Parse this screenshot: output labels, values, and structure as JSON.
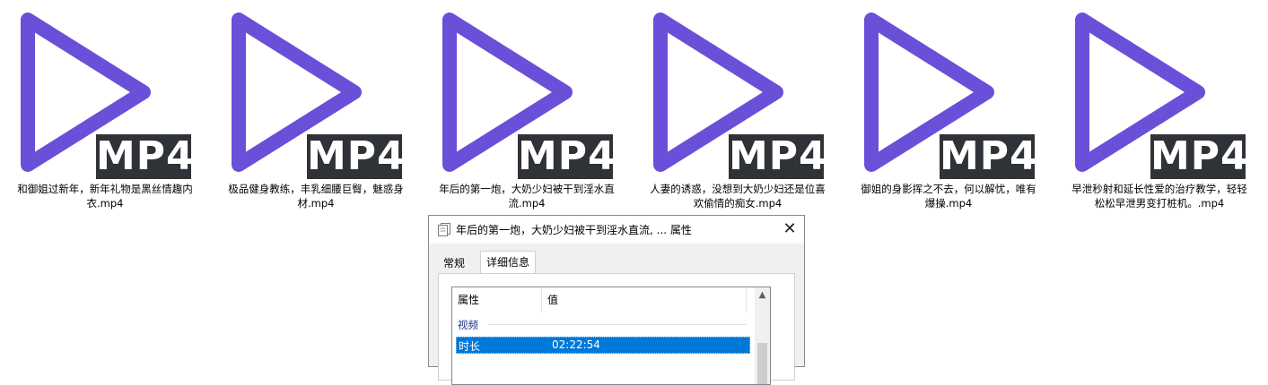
{
  "files": [
    {
      "name": "和御姐过新年，新年礼物是黑丝情趣内衣.mp4",
      "badge": "MP4",
      "icon": "play-icon"
    },
    {
      "name": "极品健身教练，丰乳细腰巨臀，魅惑身材.mp4",
      "badge": "MP4",
      "icon": "play-icon"
    },
    {
      "name": "年后的第一炮，大奶少妇被干到淫水直流.mp4",
      "badge": "MP4",
      "icon": "play-icon"
    },
    {
      "name": "人妻的诱惑，没想到大奶少妇还是位喜欢偷情的痴女.mp4",
      "badge": "MP4",
      "icon": "play-icon"
    },
    {
      "name": "御姐的身影挥之不去，何以解忧，唯有爆操.mp4",
      "badge": "MP4",
      "icon": "play-icon"
    },
    {
      "name": "早泄秒射和延长性爱的治疗教学，轻轻松松早泄男变打桩机。.mp4",
      "badge": "MP4",
      "icon": "play-icon"
    }
  ],
  "colors": {
    "play": "#6a4fd8",
    "badge_bg": "#2f3237",
    "selection": "#0078d7"
  },
  "dialog": {
    "title": "年后的第一炮，大奶少妇被干到淫水直流, ... 属性",
    "close": "✕",
    "tabs": [
      "常规",
      "详细信息"
    ],
    "active_tab": "详细信息",
    "columns": [
      "属性",
      "值"
    ],
    "group": "视频",
    "rows": [
      {
        "property": "时长",
        "value": "02:22:54"
      }
    ],
    "scroll_up": "▲"
  }
}
